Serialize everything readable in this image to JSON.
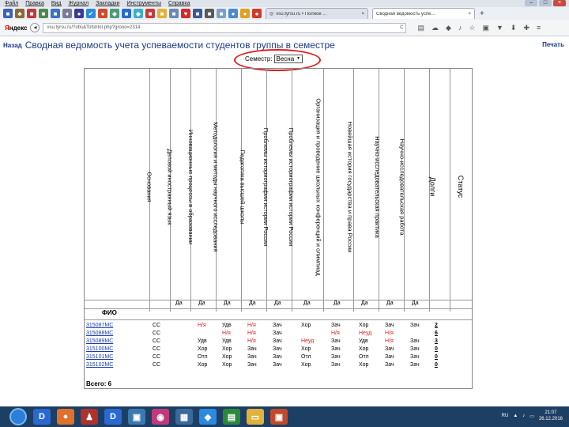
{
  "menu": [
    "Файл",
    "Правка",
    "Вид",
    "Журнал",
    "Закладки",
    "Инструменты",
    "Справка"
  ],
  "tabs": [
    {
      "title": "vsu.tyrsu.ru • Полное ..."
    },
    {
      "title": "Сводная ведомость успе..."
    }
  ],
  "browser": {
    "brand_ya": "Я",
    "brand_rest": "ндекс",
    "url": "vsu.tyrsu.ru/?obs&Tofshtot.php?grooo=2314",
    "refresh": "C"
  },
  "page": {
    "back": "Назад",
    "title": "Сводная ведомость учета успеваемости студентов группы в семестре",
    "print": "Печать"
  },
  "semester": {
    "label": "Семестр:",
    "value": "Весна"
  },
  "colors": {
    "accent": "#1a3a8a",
    "link": "#1a3aa8",
    "fail": "#e02020",
    "highlight": "#e01c1c",
    "taskbar": "#1e3f64"
  },
  "table": {
    "columns": [
      "Основания",
      "Деловой иностранный язык",
      "Инновационные процессы в образовании",
      "Методология и методы научного исследования",
      "Педагогика высшей школы",
      "Проблемы историографии истории России",
      "Проблемы историографии истории России",
      "Организация и проведение школьных конференций и олимпиад",
      "Новейшая история государства и права России",
      "Научно-исследовательская практика",
      "Научно-исследовательская работа",
      "Долги",
      "Статус"
    ],
    "da": [
      "Да",
      "Да",
      "Да",
      "Да",
      "Да",
      "Да",
      "Да",
      "Да",
      "Да",
      "Да"
    ],
    "fio_label": "ФИО",
    "rows": [
      {
        "name": "315087МС",
        "basis": "СС",
        "cells": [
          "",
          "Н/я",
          "Удв",
          "Н/я",
          "Зач",
          "Хор",
          "Зач",
          "Хор",
          "Зач",
          "Зач"
        ],
        "debts": "2"
      },
      {
        "name": "315088МС",
        "basis": "СС",
        "cells": [
          "",
          "",
          "Н/я",
          "Н/я",
          "Зач",
          "",
          "Н/я",
          "Неуд",
          "Н/я",
          ""
        ],
        "debts": "6"
      },
      {
        "name": "315089МС",
        "basis": "СС",
        "cells": [
          "",
          "Удв",
          "Удв",
          "Н/я",
          "Зач",
          "Неуд",
          "Зач",
          "Удв",
          "Н/я",
          "Зач"
        ],
        "debts": "3"
      },
      {
        "name": "315100МС",
        "basis": "СС",
        "cells": [
          "",
          "Хор",
          "Хор",
          "Зач",
          "Зач",
          "Хор",
          "Зач",
          "Хор",
          "Зач",
          "Зач"
        ],
        "debts": "0"
      },
      {
        "name": "315101МС",
        "basis": "СС",
        "cells": [
          "",
          "Отл",
          "Хор",
          "Зач",
          "Зач",
          "Отл",
          "Зач",
          "Отл",
          "Зач",
          "Зач"
        ],
        "debts": "0"
      },
      {
        "name": "315102МС",
        "basis": "СС",
        "cells": [
          "",
          "Хор",
          "Хор",
          "Зач",
          "Зач",
          "Хор",
          "Зач",
          "Хор",
          "Зач",
          "Зач"
        ],
        "debts": "0"
      }
    ],
    "total": "Всего: 6"
  },
  "tray": {
    "lang": "RU",
    "time": "21:07",
    "date": "26.12.2016"
  }
}
